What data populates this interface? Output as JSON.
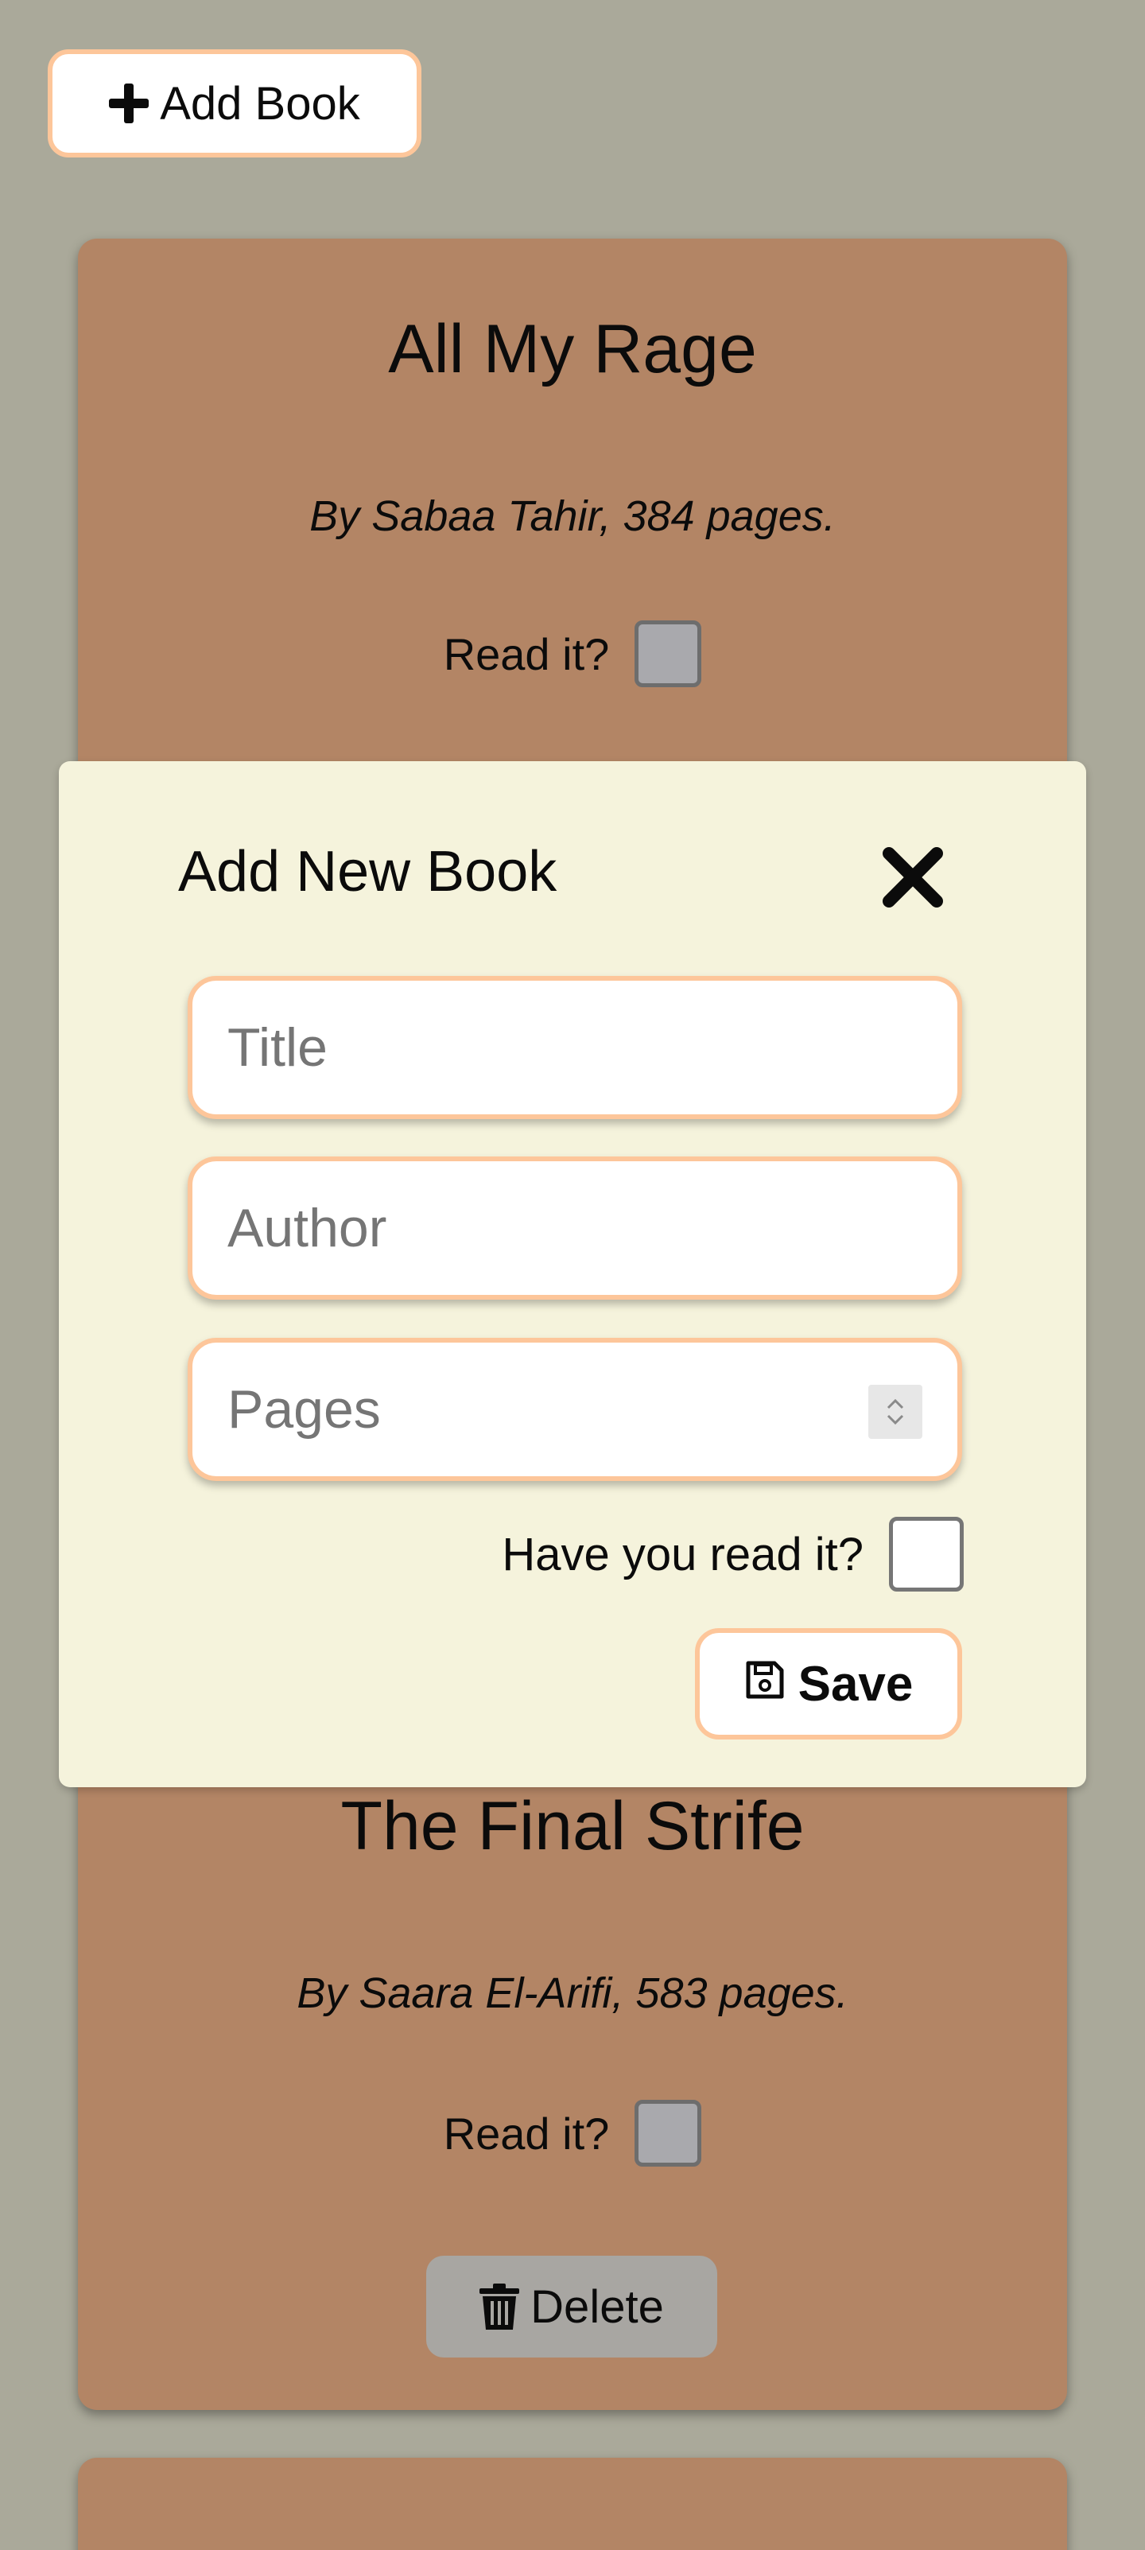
{
  "toolbar": {
    "add_book_label": "Add Book",
    "add_icon": "plus-icon"
  },
  "books": [
    {
      "title": "All My Rage",
      "meta": "By Sabaa Tahir, 384 pages.",
      "read_label": "Read it?",
      "read": false
    },
    {
      "title": "The Final Strife",
      "meta": "By Saara El-Arifi, 583 pages.",
      "read_label": "Read it?",
      "read": false,
      "delete_label": "Delete",
      "delete_icon": "trash-icon"
    }
  ],
  "modal": {
    "title": "Add New Book",
    "close_icon": "close-icon",
    "fields": {
      "title_placeholder": "Title",
      "title_value": "",
      "author_placeholder": "Author",
      "author_value": "",
      "pages_placeholder": "Pages",
      "pages_value": ""
    },
    "read_label": "Have you read it?",
    "read": false,
    "save_label": "Save",
    "save_icon": "floppy-disk-icon"
  },
  "colors": {
    "background": "#aaa99a",
    "card": "#b38565",
    "modal": "#f5f3dc",
    "accent_border": "#fdc69a",
    "delete_button": "#a8a6a2"
  }
}
